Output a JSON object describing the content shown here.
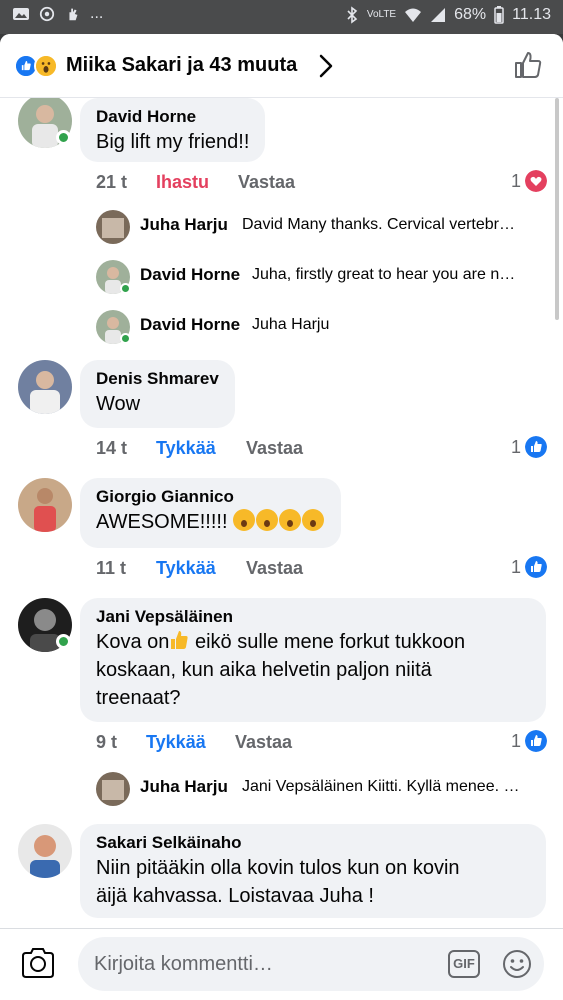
{
  "statusbar": {
    "left_icons": [
      "image-icon",
      "whatsapp-icon",
      "hand-icon"
    ],
    "dots": "...",
    "network": "VoLTE",
    "battery": "68%",
    "time": "11.13"
  },
  "header": {
    "title": "Miika Sakari ja 43 muuta",
    "reactions": [
      "like",
      "wow"
    ]
  },
  "comments": [
    {
      "name": "David Horne",
      "text": "Big lift my friend!!",
      "time": "21 t",
      "like_label": "Ihastu",
      "reply_label": "Vastaa",
      "reaction_count": "1",
      "reaction_type": "love",
      "online": true,
      "avatar_color": "#8a9a7a",
      "replies": [
        {
          "name": "Juha Harju",
          "text": "David Many thanks. Cervical vertebr…",
          "avatar_color": "#7a6a5a",
          "online": false
        },
        {
          "name": "David Horne",
          "text": "Juha, firstly great to hear you are n…",
          "avatar_color": "#8a9a7a",
          "online": true
        },
        {
          "name": "David Horne",
          "text": "Juha Harju",
          "avatar_color": "#8a9a7a",
          "online": true
        }
      ]
    },
    {
      "name": "Denis Shmarev",
      "text": "Wow",
      "time": "14 t",
      "like_label": "Tykkää",
      "reply_label": "Vastaa",
      "reaction_count": "1",
      "reaction_type": "like",
      "online": false,
      "avatar_color": "#5a6a8a",
      "replies": []
    },
    {
      "name": "Giorgio Giannico",
      "text": "AWESOME!!!!!",
      "emoji_count": 4,
      "time": "11 t",
      "like_label": "Tykkää",
      "reply_label": "Vastaa",
      "reaction_count": "1",
      "reaction_type": "like",
      "online": false,
      "avatar_color": "#9a5a4a",
      "replies": []
    },
    {
      "name": "Jani Vepsäläinen",
      "text_line1_a": "Kova on",
      "text_line1_b": " eikö sulle mene forkut tukkoon",
      "text_line2": "koskaan, kun aika helvetin paljon niitä",
      "text_line3": "treenaat?",
      "time": "9 t",
      "like_label": "Tykkää",
      "reply_label": "Vastaa",
      "reaction_count": "1",
      "reaction_type": "like",
      "online": true,
      "avatar_color": "#2a2a2a",
      "replies": [
        {
          "name": "Juha Harju",
          "text": "Jani Vepsäläinen Kiitti. Kyllä menee. …",
          "avatar_color": "#7a6a5a",
          "online": false
        }
      ]
    },
    {
      "name": "Sakari Selkäinaho",
      "text_line1": "Niin pitääkin olla kovin tulos kun on kovin",
      "text_line2": "äijä kahvassa. Loistavaa Juha !",
      "online": false,
      "avatar_color": "#5a7aaa",
      "replies": []
    }
  ],
  "composer": {
    "placeholder": "Kirjoita kommentti…",
    "gif_label": "GIF"
  },
  "colors": {
    "accent": "#1877f2",
    "love": "#e4405f",
    "online": "#31a24c",
    "bubble": "#f0f2f5"
  }
}
